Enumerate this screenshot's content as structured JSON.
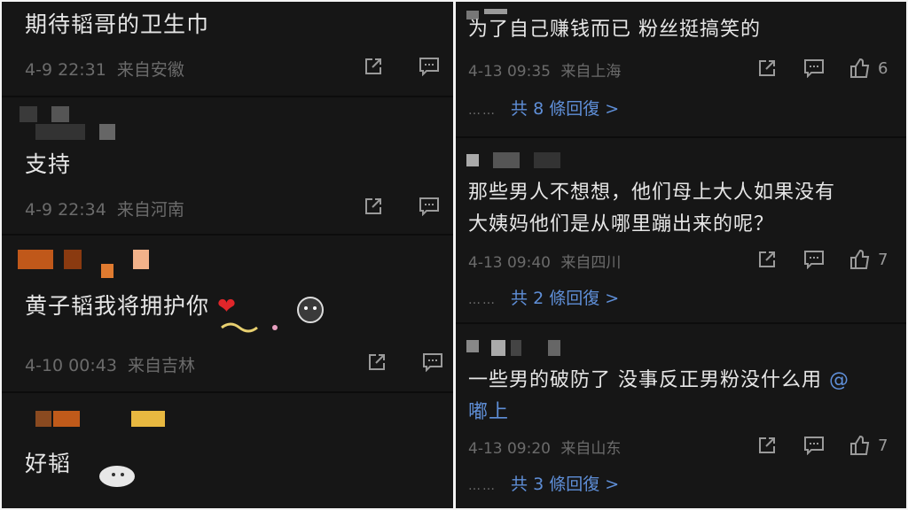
{
  "left": {
    "comments": [
      {
        "text": "期待韬哥的卫生巾",
        "time": "4-9 22:31",
        "location": "来自安徽"
      },
      {
        "text": "支持",
        "time": "4-9 22:34",
        "location": "来自河南"
      },
      {
        "text": "黄子韬我将拥护你",
        "time": "4-10 00:43",
        "location": "来自吉林"
      },
      {
        "text": "好韬"
      }
    ]
  },
  "right": {
    "comments": [
      {
        "text": "为了自己赚钱而已 粉丝挺搞笑的",
        "time": "4-13 09:35",
        "location": "来自上海",
        "likes": "6",
        "replies": "共 8 條回復 >"
      },
      {
        "text_line1": "那些男人不想想，他们母上大人如果没有",
        "text_line2": "大姨妈他们是从哪里蹦出来的呢？",
        "time": "4-13 09:40",
        "location": "来自四川",
        "likes": "7",
        "replies": "共 2 條回復 >"
      },
      {
        "text_line1": "一些男的破防了 没事反正男粉没什么用",
        "mention_at": "@",
        "text_line2": "嘟上",
        "time": "4-13 09:20",
        "location": "来自山东",
        "likes": "7",
        "replies": "共 3 條回復 >"
      }
    ],
    "dots": "……"
  },
  "icons": {
    "share": "share-icon",
    "comment": "comment-icon",
    "like": "thumbs-up-icon",
    "heart": "heart-emoji"
  },
  "colors": {
    "background": "#161616",
    "text": "#e6e6e6",
    "meta": "#6b6b6b",
    "link": "#5f8fd8"
  }
}
